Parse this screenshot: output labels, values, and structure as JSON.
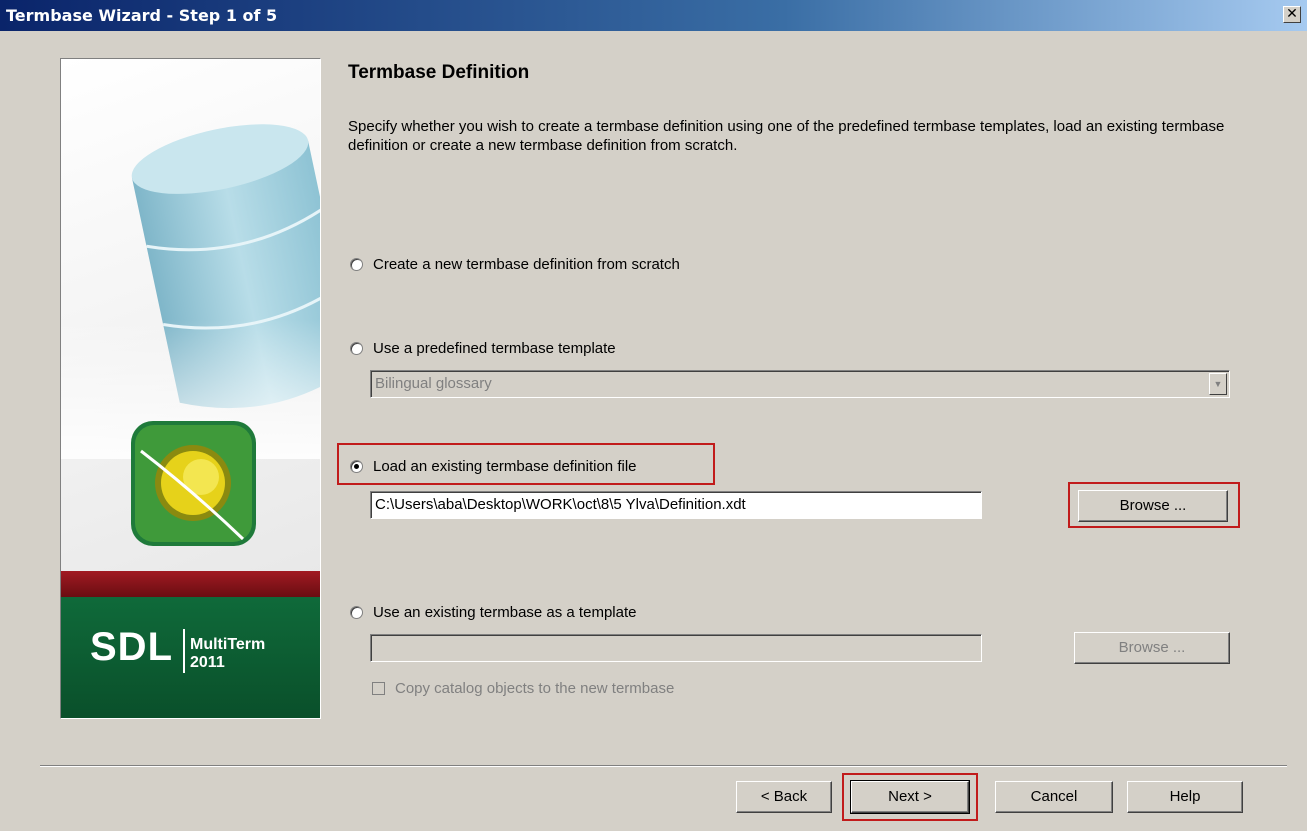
{
  "window": {
    "title": "Termbase Wizard - Step 1 of 5",
    "close_glyph": "✕"
  },
  "side_panel": {
    "brand_logo": "SDL",
    "product_name": "MultiTerm",
    "product_year": "2011"
  },
  "page": {
    "heading": "Termbase Definition",
    "description": "Specify whether you wish to create a termbase definition using one of the predefined termbase templates, load an existing termbase definition or create a new termbase definition from scratch."
  },
  "options": {
    "create_new": {
      "label": "Create a new termbase definition from scratch",
      "selected": false
    },
    "predefined": {
      "label": "Use a predefined termbase template",
      "selected": false,
      "template_value": "Bilingual glossary"
    },
    "load_existing": {
      "label": "Load an existing termbase definition file",
      "selected": true,
      "file_path": "C:\\Users\\aba\\Desktop\\WORK\\oct\\8\\5 Ylva\\Definition.xdt",
      "browse_label": "Browse ..."
    },
    "existing_termbase": {
      "label": "Use an existing termbase as a template",
      "selected": false,
      "value": "",
      "browse_label": "Browse ...",
      "copy_catalog_label": "Copy catalog objects to the new termbase"
    }
  },
  "footer": {
    "back_label": "< Back",
    "next_label": "Next >",
    "cancel_label": "Cancel",
    "help_label": "Help"
  },
  "colors": {
    "highlight": "#c11b1b",
    "dialog_bg": "#d4d0c8",
    "brand_green": "#0f6a3a",
    "brand_red": "#a11a22"
  }
}
